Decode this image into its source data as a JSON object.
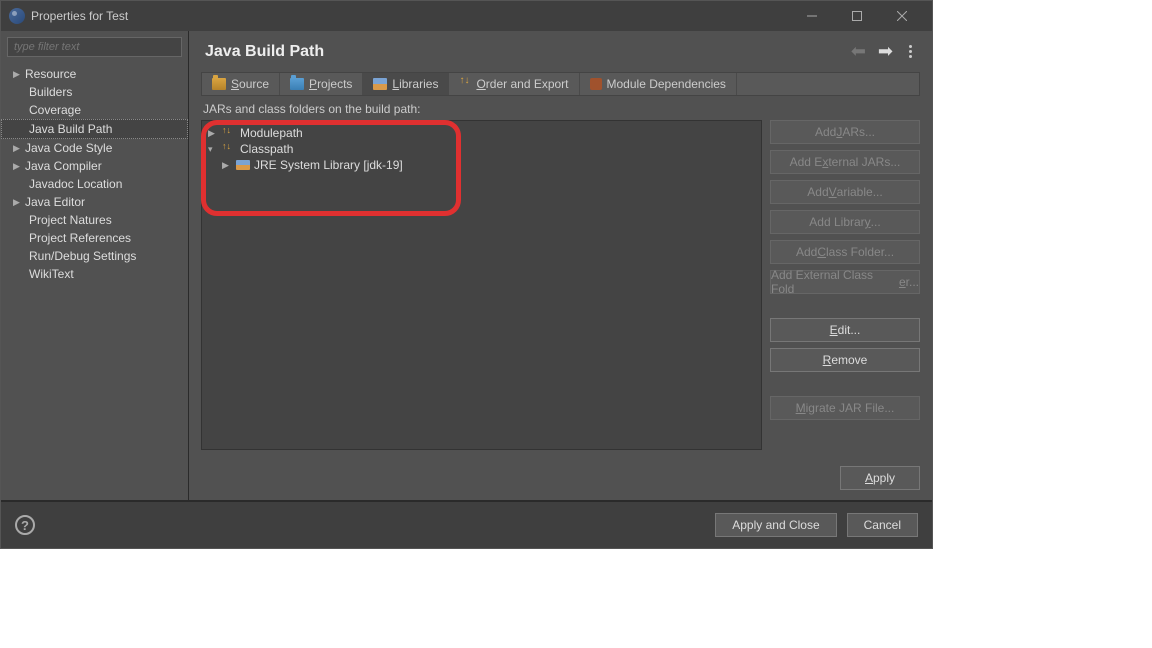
{
  "titlebar": {
    "title": "Properties for Test"
  },
  "sidebar": {
    "filter_placeholder": "type filter text",
    "items": [
      {
        "label": "Resource",
        "expandable": true
      },
      {
        "label": "Builders"
      },
      {
        "label": "Coverage"
      },
      {
        "label": "Java Build Path",
        "selected": true
      },
      {
        "label": "Java Code Style",
        "expandable": true
      },
      {
        "label": "Java Compiler",
        "expandable": true
      },
      {
        "label": "Javadoc Location"
      },
      {
        "label": "Java Editor",
        "expandable": true
      },
      {
        "label": "Project Natures"
      },
      {
        "label": "Project References"
      },
      {
        "label": "Run/Debug Settings"
      },
      {
        "label": "WikiText"
      }
    ]
  },
  "content": {
    "title": "Java Build Path",
    "tabs": {
      "source": "Source",
      "projects": "Projects",
      "libraries": "Libraries",
      "order": "Order and Export",
      "module": "Module Dependencies"
    },
    "hint": "JARs and class folders on the build path:",
    "tree": {
      "modulepath": "Modulepath",
      "classpath": "Classpath",
      "jre": "JRE System Library [jdk-19]"
    },
    "buttons": {
      "add_jars": "Add JARs...",
      "add_ext_jars": "Add External JARs...",
      "add_variable": "Add Variable...",
      "add_library": "Add Library...",
      "add_class_folder": "Add Class Folder...",
      "add_ext_class_folder": "Add External Class Folder...",
      "edit": "Edit...",
      "remove": "Remove",
      "migrate": "Migrate JAR File..."
    },
    "apply": "Apply"
  },
  "footer": {
    "apply_close": "Apply and Close",
    "cancel": "Cancel"
  }
}
